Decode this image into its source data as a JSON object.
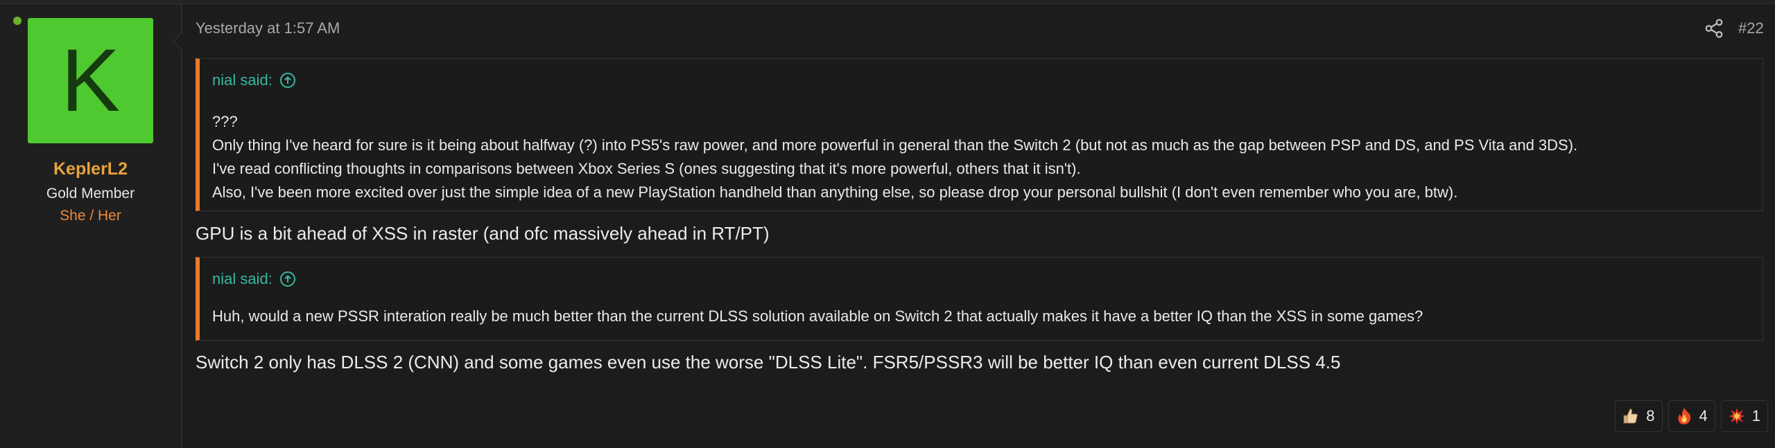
{
  "user": {
    "avatar_letter": "K",
    "name": "KeplerL2",
    "title": "Gold Member",
    "pronouns": "She / Her",
    "online_color": "#6ab42a",
    "avatar_color": "#4ec92f"
  },
  "post": {
    "date": "Yesterday at 1:57 AM",
    "number": "#22",
    "share_icon": "share-icon"
  },
  "quotes": [
    {
      "author": "nial said:",
      "lines": [
        "???",
        "Only thing I've heard for sure is it being about halfway (?) into PS5's raw power, and more powerful in general than the Switch 2 (but not as much as the gap between PSP and DS, and PS Vita and 3DS).",
        "I've read conflicting thoughts in comparisons between Xbox Series S (ones suggesting that it's more powerful, others that it isn't).",
        "Also, I've been more excited over just the simple idea of a new PlayStation handheld than anything else, so please drop your personal bullshit (I don't even remember who you are, btw)."
      ]
    },
    {
      "author": "nial said:",
      "lines": [
        "Huh, would a new PSSR interation really be much better than the current DLSS solution available on Switch 2 that actually makes it have a better IQ than the XSS in some games?"
      ]
    }
  ],
  "replies": [
    "GPU is a bit ahead of XSS in raster (and ofc massively ahead in RT/PT)",
    "Switch 2 only has DLSS 2 (CNN) and some games even use the worse \"DLSS Lite\". FSR5/PSSR3 will be better IQ than even current DLSS 4.5"
  ],
  "reactions": [
    {
      "icon": "thumbs-up-icon",
      "count": "8"
    },
    {
      "icon": "fire-icon",
      "count": "4"
    },
    {
      "icon": "explosion-icon",
      "count": "1"
    }
  ],
  "colors": {
    "accent_quote_bar": "#e97b2c",
    "quote_author": "#37b89e",
    "username": "#e8a33a",
    "pronouns": "#ee8a3c"
  }
}
